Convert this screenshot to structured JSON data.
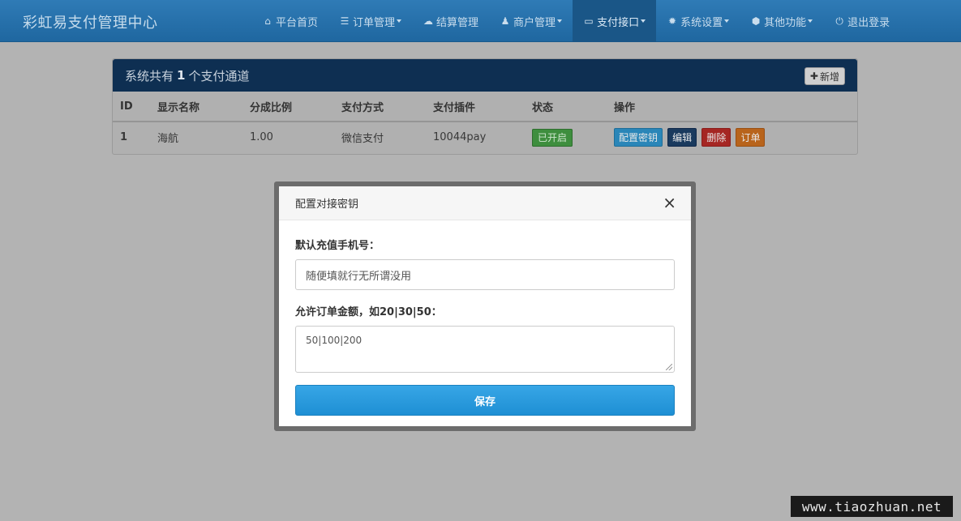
{
  "brand": "彩虹易支付管理中心",
  "nav": [
    {
      "icon": "home-icon",
      "glyph": "⌂",
      "label": "平台首页",
      "dropdown": false,
      "active": false
    },
    {
      "icon": "list-icon",
      "glyph": "☰",
      "label": "订单管理",
      "dropdown": true,
      "active": false
    },
    {
      "icon": "cloud-icon",
      "glyph": "☁",
      "label": "结算管理",
      "dropdown": false,
      "active": false
    },
    {
      "icon": "user-icon",
      "glyph": "♟",
      "label": "商户管理",
      "dropdown": true,
      "active": false
    },
    {
      "icon": "card-icon",
      "glyph": "▭",
      "label": "支付接口",
      "dropdown": true,
      "active": true
    },
    {
      "icon": "gear-icon",
      "glyph": "✹",
      "label": "系统设置",
      "dropdown": true,
      "active": false
    },
    {
      "icon": "cube-icon",
      "glyph": "⬢",
      "label": "其他功能",
      "dropdown": true,
      "active": false
    },
    {
      "icon": "power-icon",
      "glyph": "⏻",
      "label": "退出登录",
      "dropdown": false,
      "active": false
    }
  ],
  "panel": {
    "title_prefix": "系统共有",
    "count": "1",
    "title_suffix": "个支付通道",
    "add_label": "新增",
    "columns": [
      "ID",
      "显示名称",
      "分成比例",
      "支付方式",
      "支付插件",
      "状态",
      "操作"
    ],
    "rows": [
      {
        "id": "1",
        "name": "海航",
        "ratio": "1.00",
        "method": "微信支付",
        "plugin": "10044pay",
        "status": "已开启",
        "actions": [
          "配置密钥",
          "编辑",
          "删除",
          "订单"
        ]
      }
    ]
  },
  "modal": {
    "title": "配置对接密钥",
    "close": "×",
    "field1_label": "默认充值手机号：",
    "field1_value": "随便填就行无所谓没用",
    "field2_label": "允许订单金额，如20|30|50：",
    "field2_value": "50|100|200",
    "save_label": "保存"
  },
  "watermark": "www.tiaozhuan.net"
}
